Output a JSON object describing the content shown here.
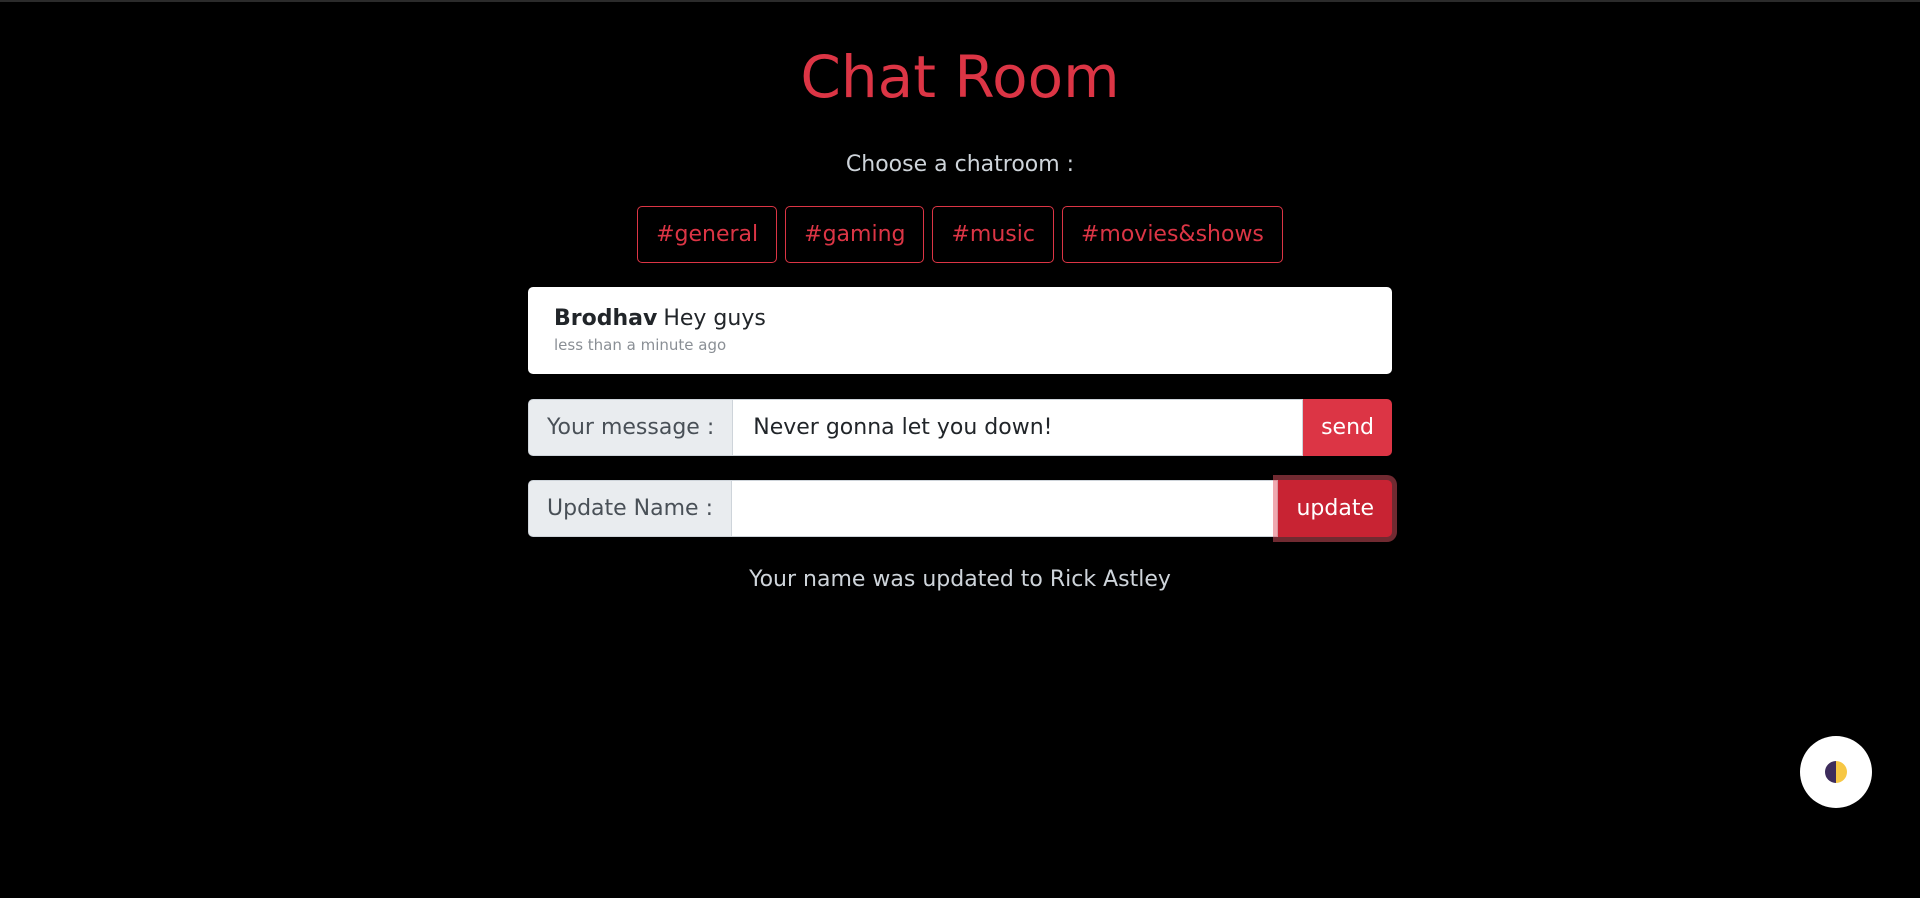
{
  "page": {
    "title": "Chat Room",
    "choose_label": "Choose a chatroom :"
  },
  "rooms": [
    {
      "label": "#general"
    },
    {
      "label": "#gaming"
    },
    {
      "label": "#music"
    },
    {
      "label": "#movies&shows"
    }
  ],
  "messages": [
    {
      "author": "Brodhav",
      "text": "Hey guys",
      "time": "less than a minute ago"
    }
  ],
  "message_form": {
    "label": "Your message :",
    "value": "Never gonna let you down!",
    "button_label": "send"
  },
  "name_form": {
    "label": "Update Name :",
    "value": "",
    "button_label": "update"
  },
  "status": {
    "text": "Your name was updated to Rick Astley"
  },
  "theme_toggle": {
    "icon": "contrast-icon",
    "colors": [
      "#3d2c5c",
      "#f7c744"
    ]
  },
  "colors": {
    "background": "#000000",
    "accent": "#dc3545",
    "muted_text": "#ced4da"
  }
}
